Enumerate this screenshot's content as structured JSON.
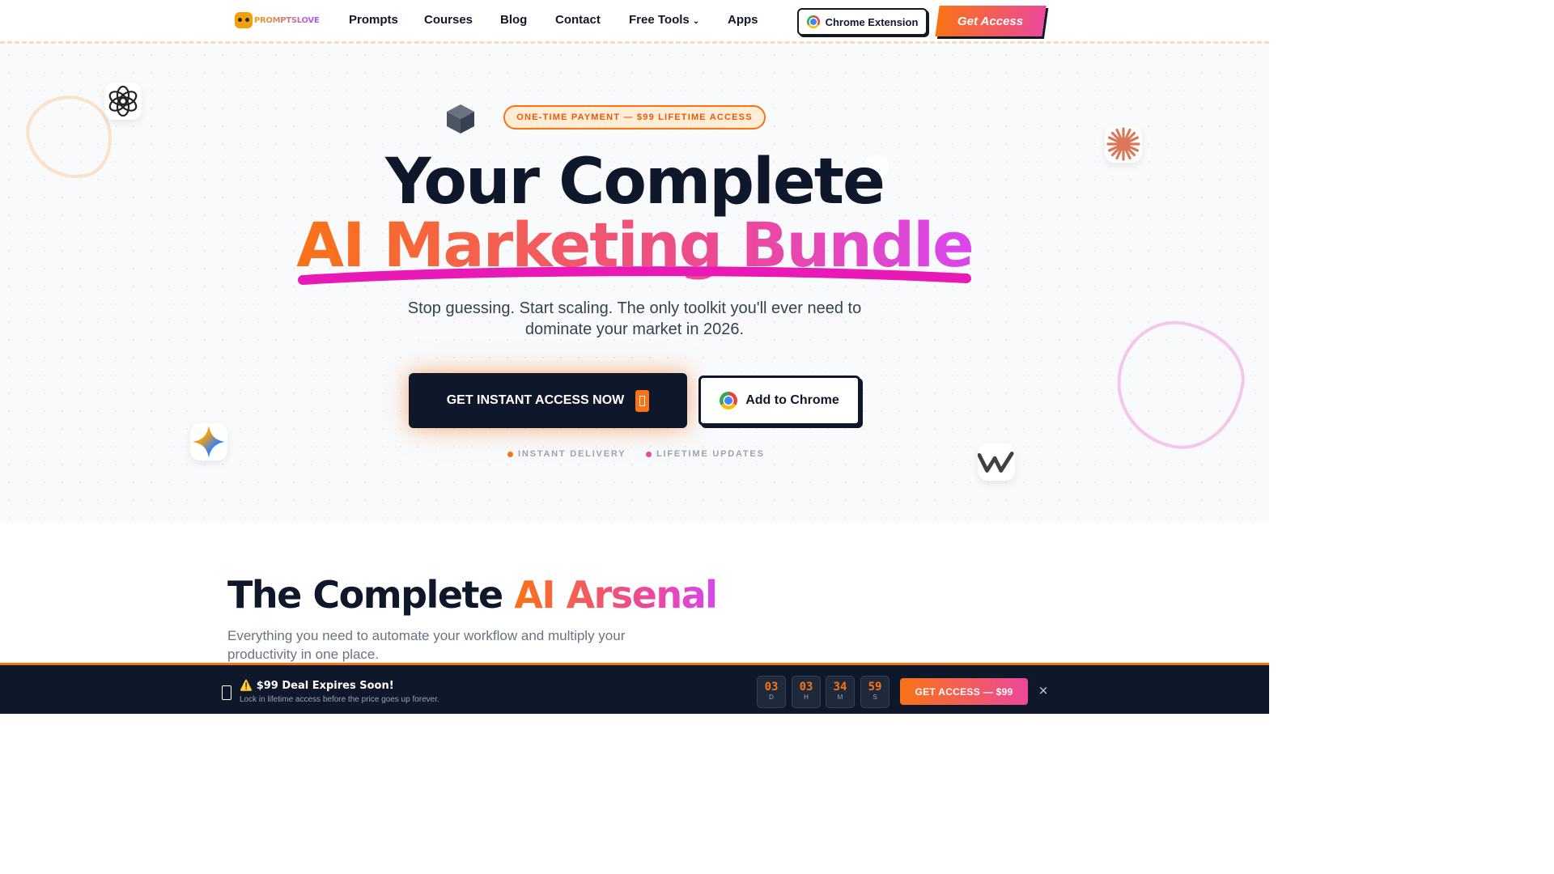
{
  "nav": {
    "logo_text": "PROMPTSLOVE",
    "links": [
      "Prompts",
      "Courses",
      "Blog",
      "Contact",
      "Free Tools",
      "Apps"
    ],
    "chrome_extension": "Chrome Extension",
    "get_access": "Get Access"
  },
  "hero": {
    "badge": "ONE-TIME PAYMENT — $99 LIFETIME ACCESS",
    "title_line1": "Your Complete",
    "title_line2": "AI Marketing Bundle",
    "subtitle": "Stop guessing. Start scaling. The only toolkit you'll ever need to dominate your market in 2026.",
    "cta_primary": "GET INSTANT ACCESS NOW",
    "cta_secondary": "Add to Chrome",
    "features": [
      {
        "label": "INSTANT DELIVERY",
        "color": "#f97316"
      },
      {
        "label": "LIFETIME UPDATES",
        "color": "#ec4899"
      }
    ],
    "floating_icons": [
      "openai-icon",
      "perplexity-icon",
      "claude-icon",
      "gemini-icon",
      "writesonic-icon"
    ]
  },
  "section2": {
    "title_plain": "The Complete ",
    "title_accent": "AI Arsenal",
    "subtitle": "Everything you need to automate your workflow and multiply your productivity in one place."
  },
  "deal_bar": {
    "title": "⚠️ $99 Deal Expires Soon!",
    "subtitle": "Lock in lifetime access before the price goes up forever.",
    "countdown": [
      {
        "value": "03",
        "unit": "D"
      },
      {
        "value": "03",
        "unit": "H"
      },
      {
        "value": "34",
        "unit": "M"
      },
      {
        "value": "59",
        "unit": "S"
      }
    ],
    "button": "GET ACCESS — $99",
    "close": "×"
  },
  "colors": {
    "accent_orange": "#f97316",
    "accent_pink": "#ec4899",
    "dark": "#0f172a"
  }
}
